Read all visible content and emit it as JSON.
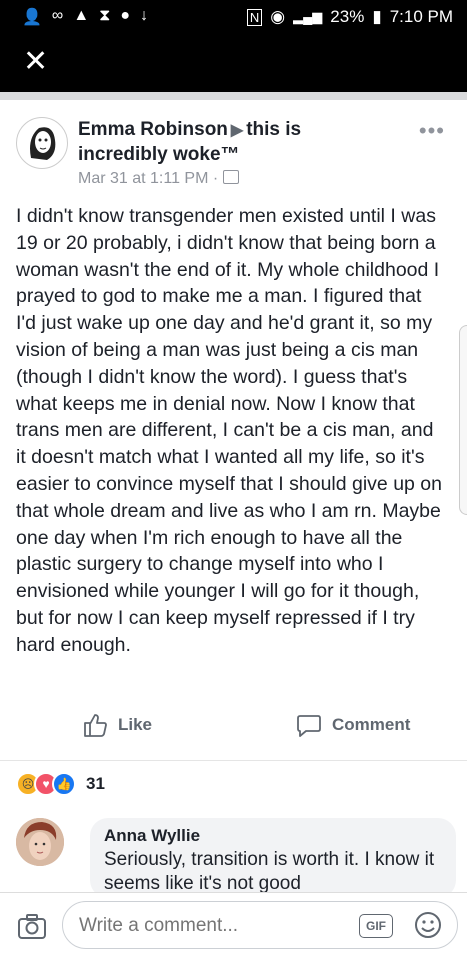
{
  "status_bar": {
    "battery": "23%",
    "time": "7:10 PM",
    "left_icons": [
      "notification-icon",
      "voicemail-icon",
      "alert-icon",
      "hourglass-icon",
      "messenger-icon",
      "download-icon"
    ],
    "right_icons": [
      "dnd-icon",
      "nfc-icon",
      "location-icon",
      "signal-icon",
      "battery-icon"
    ]
  },
  "post": {
    "author": "Emma Robinson",
    "group": "this is incredibly woke™",
    "date": "Mar 31 at 1:11 PM",
    "separator": "·",
    "body": "I didn't know transgender men existed until I was 19 or 20 probably, i didn't know that being born a woman wasn't the end of it. My whole childhood I prayed to god to make me a man. I figured that I'd just wake up one day and he'd grant it, so my vision of being a man was just being a cis man (though I didn't know the word). I guess that's what keeps me in denial now. Now I know that trans men are different, I can't be a cis man, and it doesn't match what I wanted all my life, so it's easier to convince myself that I should give up on that whole dream and live as who I am rn. Maybe one day when I'm rich enough to have all the plastic surgery to change myself into who I envisioned while younger I will go for it though, but for now I can keep myself repressed if I try hard enough.",
    "like_label": "Like",
    "comment_label": "Comment",
    "reaction_count": "31",
    "reactions": [
      "sad",
      "love",
      "like"
    ]
  },
  "comment": {
    "name": "Anna Wyllie",
    "text": "Seriously, transition is worth it. I know it seems like it's not good"
  },
  "composer": {
    "placeholder": "Write a comment...",
    "gif_label": "GIF"
  },
  "colors": {
    "brand_blue": "#1877f2",
    "text": "#1d2129",
    "muted": "#90949c"
  }
}
